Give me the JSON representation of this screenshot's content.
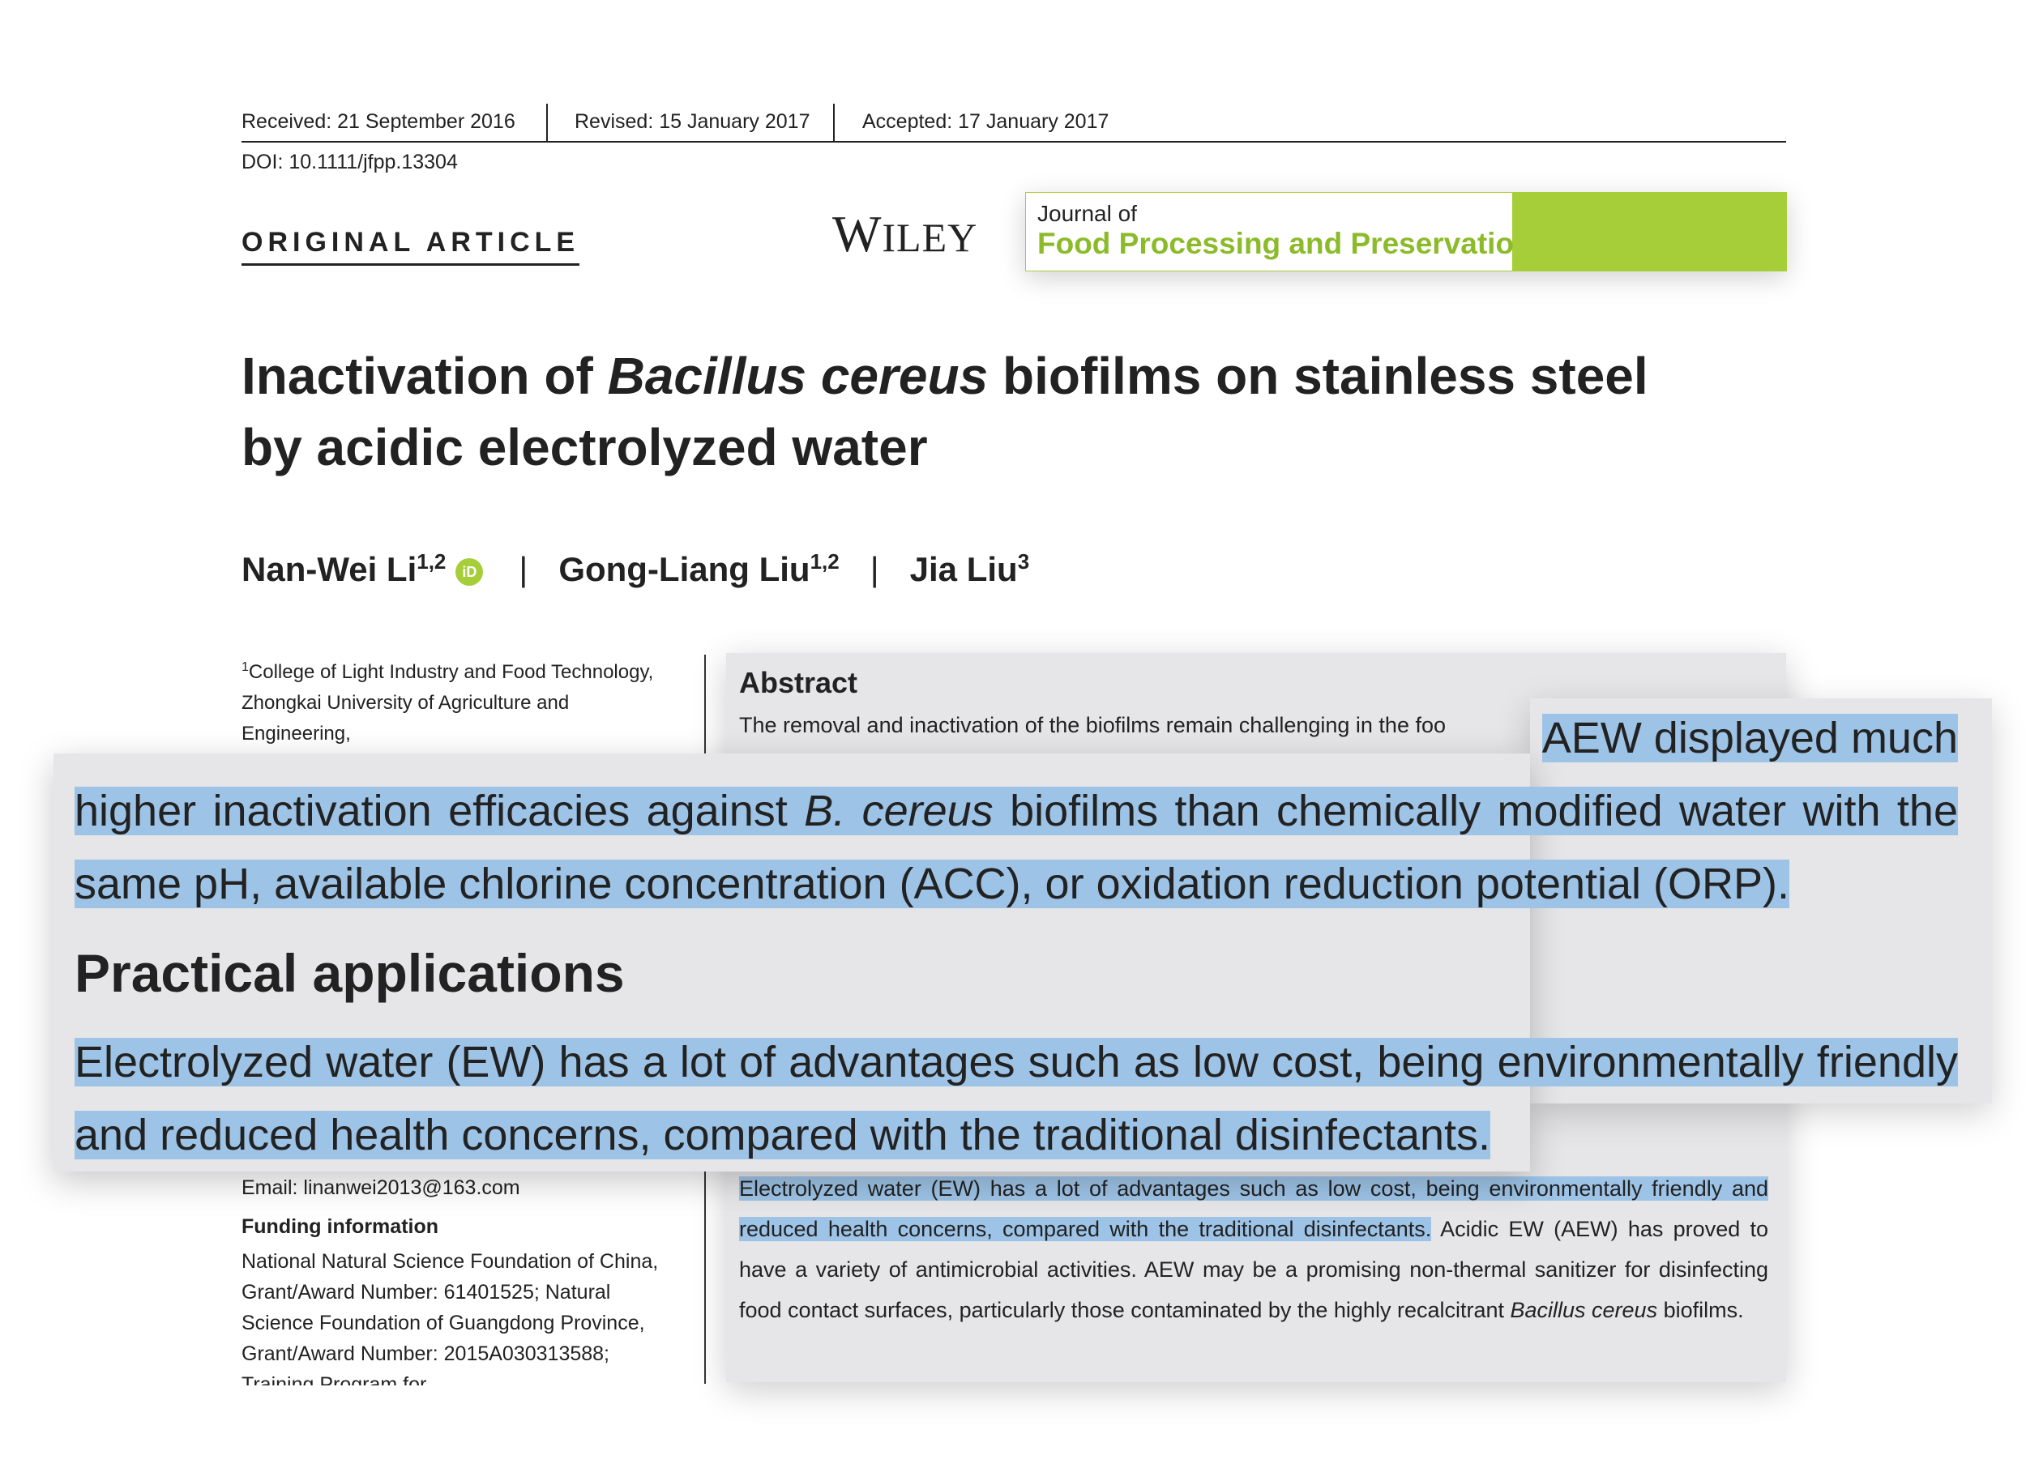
{
  "meta": {
    "received": "Received: 21 September 2016",
    "revised": "Revised: 15 January 2017",
    "accepted": "Accepted: 17 January 2017",
    "doi": "DOI: 10.1111/jfpp.13304"
  },
  "article_type": "ORIGINAL ARTICLE",
  "publisher": "Wiley",
  "journal": {
    "line1": "Journal of",
    "line2": "Food Processing and Preservation"
  },
  "title": {
    "part1": "Inactivation of ",
    "italic": "Bacillus cereus",
    "part2": " biofilms on stainless steel by acidic electrolyzed water"
  },
  "authors": [
    {
      "name": "Nan-Wei Li",
      "sup": "1,2",
      "orcid": "iD"
    },
    {
      "name": "Gong-Liang Liu",
      "sup": "1,2"
    },
    {
      "name": "Jia Liu",
      "sup": "3"
    }
  ],
  "affiliation": {
    "sup": "1",
    "text": "College of Light Industry and Food Technology, Zhongkai University of Agriculture and Engineering,"
  },
  "email": "Email: linanwei2013@163.com",
  "funding": {
    "heading": "Funding information",
    "text": "National Natural Science Foundation of China, Grant/Award Number: 61401525; Natural Science Foundation of Guangdong Province, Grant/Award Number: 2015A030313588; Training Program for"
  },
  "abstract": {
    "heading": "Abstract",
    "first_line": "The removal and inactivation of the biofilms remain challenging in the foo",
    "practical_hl": "Electrolyzed water (EW) has a lot of advantages such as low cost, being environmentally friendly and reduced health concerns, compared with the traditional disinfectants.",
    "practical_rest_1": " Acidic EW (AEW) has proved to have a variety of antimicrobial activities. AEW may be a promising non-thermal sanitizer for disinfecting food contact surfaces, particularly those contaminated by the highly recalcitrant ",
    "practical_rest_italic": "Bacillus cereus",
    "practical_rest_2": " biofilms."
  },
  "zoom": {
    "line1": "AEW displayed much",
    "para_a": "higher inactivation efficacies against ",
    "para_italic": "B. cereus",
    "para_b": " biofilms than chemically modified water with the same pH, available chlorine concentration (ACC), or oxidation reduction potential (ORP).",
    "heading": "Practical applications",
    "practical": "Electrolyzed water (EW) has a lot of advantages such as low cost, being environmentally friendly and reduced health concerns, compared with the traditional disinfectants."
  },
  "colors": {
    "highlight": "#9dc3e6",
    "journal_green": "#a6ce39",
    "panel_gray": "#e6e6e8"
  }
}
